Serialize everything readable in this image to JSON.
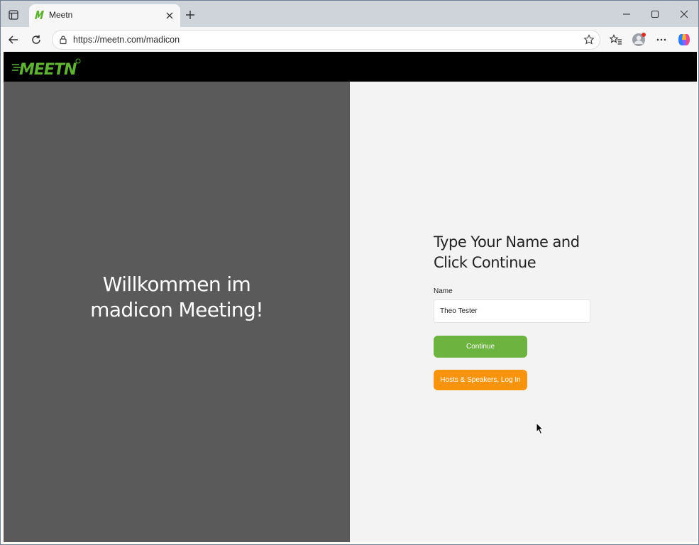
{
  "browser": {
    "tab": {
      "title": "Meetn"
    },
    "address_bar": {
      "url": "https://meetn.com/madicon"
    },
    "icons": [
      "tab-actions-icon",
      "meetn-favicon",
      "close-icon",
      "plus-icon",
      "minimize-icon",
      "maximize-icon",
      "close-window-icon",
      "back-arrow-icon",
      "reload-icon",
      "lock-icon",
      "star-icon",
      "favorites-icon",
      "profile-icon",
      "more-icon",
      "copilot-icon"
    ]
  },
  "site": {
    "logo_text": "MEETN",
    "welcome_text": "Willkommen im madicon Meeting!",
    "form": {
      "title": "Type Your Name and Click Continue",
      "name_label": "Name",
      "name_value": "Theo Tester",
      "continue_label": "Continue",
      "login_label": "Hosts & Speakers, Log In"
    }
  },
  "colors": {
    "header_bg": "#000000",
    "left_panel_bg": "#5a5a5a",
    "right_panel_bg": "#f3f3f3",
    "continue_button": "#6cb33f",
    "login_button": "#f7940c",
    "logo_green": "#5fb233"
  }
}
